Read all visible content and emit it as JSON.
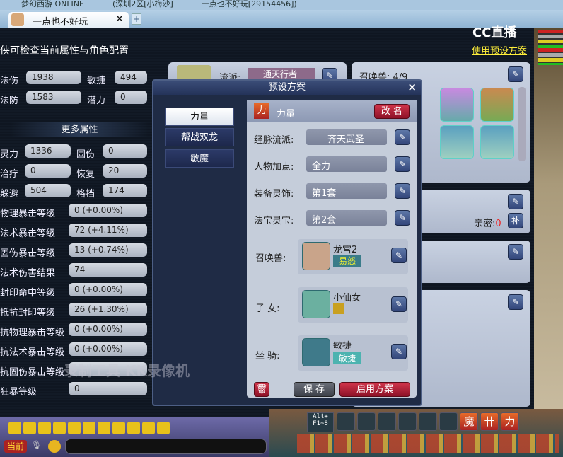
{
  "window": {
    "title_parts": [
      "梦幻西游 ONLINE",
      "(深圳2区[小梅沙]",
      "一点也不好玩[29154456])"
    ],
    "tab_label": "一点也不好玩",
    "tab_close": "×",
    "new_tab": "+"
  },
  "watermark": {
    "cc": "CC直播",
    "recorder": "录制工具 KK录像机"
  },
  "panel": {
    "header": "侠可检查当前属性与角色配置",
    "use_preset_link": "使用预设方案",
    "base_stats": [
      {
        "label": "法伤",
        "value": "1938"
      },
      {
        "label": "敏捷",
        "value": "494"
      },
      {
        "label": "法防",
        "value": "1583"
      },
      {
        "label": "潜力",
        "value": "0"
      }
    ],
    "more_title": "更多属性",
    "pair_stats": [
      {
        "label": "灵力",
        "value": "1336"
      },
      {
        "label": "固伤",
        "value": "0"
      },
      {
        "label": "治疗",
        "value": "0"
      },
      {
        "label": "恢复",
        "value": "20"
      },
      {
        "label": "躲避",
        "value": "504"
      },
      {
        "label": "格挡",
        "value": "174"
      }
    ],
    "long_stats": [
      {
        "label": "物理暴击等级",
        "value": "0 (+0.00%)"
      },
      {
        "label": "法术暴击等级",
        "value": "72 (+4.11%)"
      },
      {
        "label": "固伤暴击等级",
        "value": "13 (+0.74%)"
      },
      {
        "label": "法术伤害结果",
        "value": "74"
      },
      {
        "label": "封印命中等级",
        "value": "0 (+0.00%)"
      },
      {
        "label": "抵抗封印等级",
        "value": "26 (+1.30%)"
      },
      {
        "label": "抗物理暴击等级",
        "value": "0 (+0.00%)"
      },
      {
        "label": "抗法术暴击等级",
        "value": "0 (+0.00%)"
      },
      {
        "label": "抗固伤暴击等级",
        "value": ""
      },
      {
        "label": "狂暴等级",
        "value": "0"
      }
    ],
    "school_label": "流派:",
    "school_value": "通天行者",
    "summon_label": "召唤兽:",
    "summon_count": "4/9",
    "intimacy_label": "亲密:",
    "intimacy_value": "0",
    "refill": "补"
  },
  "dialog": {
    "title": "预设方案",
    "close": "×",
    "presets": [
      {
        "label": "力量",
        "selected": true
      },
      {
        "label": "帮战双龙"
      },
      {
        "label": "敏魔"
      }
    ],
    "current_icon": "力",
    "current_name": "力量",
    "rename": "改 名",
    "rows": [
      {
        "label": "经脉流派:",
        "value": "齐天武圣"
      },
      {
        "label": "人物加点:",
        "value": "全力"
      },
      {
        "label": "装备灵饰:",
        "value": "第1套"
      },
      {
        "label": "法宝灵宝:",
        "value": "第2套"
      }
    ],
    "summon": {
      "label": "召唤兽:",
      "name": "龙宫2",
      "tag": "易怒"
    },
    "child": {
      "label": "子 女:",
      "name": "小仙女"
    },
    "mount": {
      "label": "坐 骑:",
      "name": "敏捷",
      "tag": "敏捷"
    },
    "save": "保 存",
    "apply": "启用方案"
  },
  "bottom": {
    "channel": "当前",
    "hotkey": "Alt+ F1~8",
    "skills": [
      "魔",
      "卄",
      "力"
    ]
  }
}
